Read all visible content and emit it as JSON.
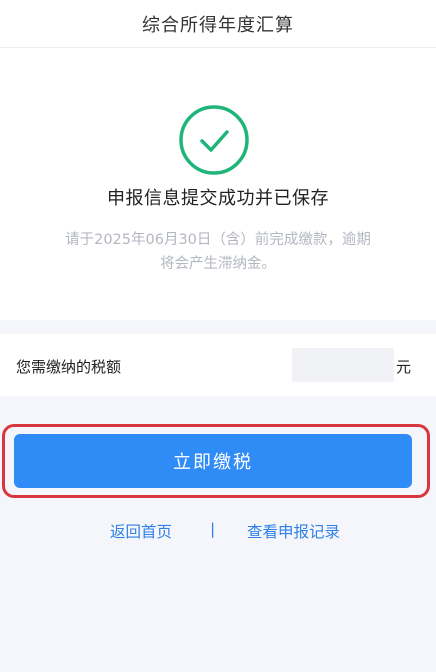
{
  "header": {
    "title": "综合所得年度汇算"
  },
  "success": {
    "title": "申报信息提交成功并已保存",
    "description": "请于2025年06月30日（含）前完成缴款，逾期将会产生滞纳金。"
  },
  "tax": {
    "label": "您需缴纳的税额",
    "unit": "元"
  },
  "actions": {
    "pay_label": "立即缴税",
    "home_link": "返回首页",
    "divider": "|",
    "records_link": "查看申报记录"
  },
  "colors": {
    "primary": "#2f8cf7",
    "link": "#2f80e8",
    "success": "#1fb57a",
    "highlight": "#d9363e"
  },
  "icons": {
    "status": "check-circle-icon"
  }
}
